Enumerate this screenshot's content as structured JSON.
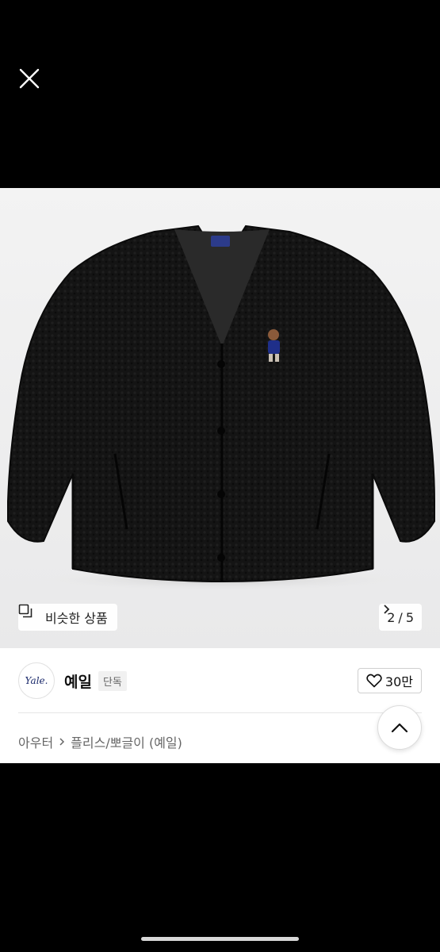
{
  "header": {
    "close_icon": "close-icon"
  },
  "gallery": {
    "similar_label": "비슷한 상품",
    "similar_icon": "copy-icon",
    "pager_current": "2",
    "pager_separator": "/",
    "pager_total": "5",
    "pager_icon": "chevron-right-icon"
  },
  "brand": {
    "logo_text": "Yale.",
    "name": "예일",
    "badge": "단독"
  },
  "like": {
    "icon": "heart-icon",
    "count": "30만"
  },
  "breadcrumb": {
    "items": [
      "아우터",
      "플리스/뽀글이 (예일)"
    ],
    "separator_icon": "chevron-right-icon"
  },
  "scroll_top": {
    "icon": "chevron-up-icon"
  },
  "colors": {
    "background": "#000000",
    "panel": "#ffffff",
    "logo_navy": "#1b2a6b"
  }
}
